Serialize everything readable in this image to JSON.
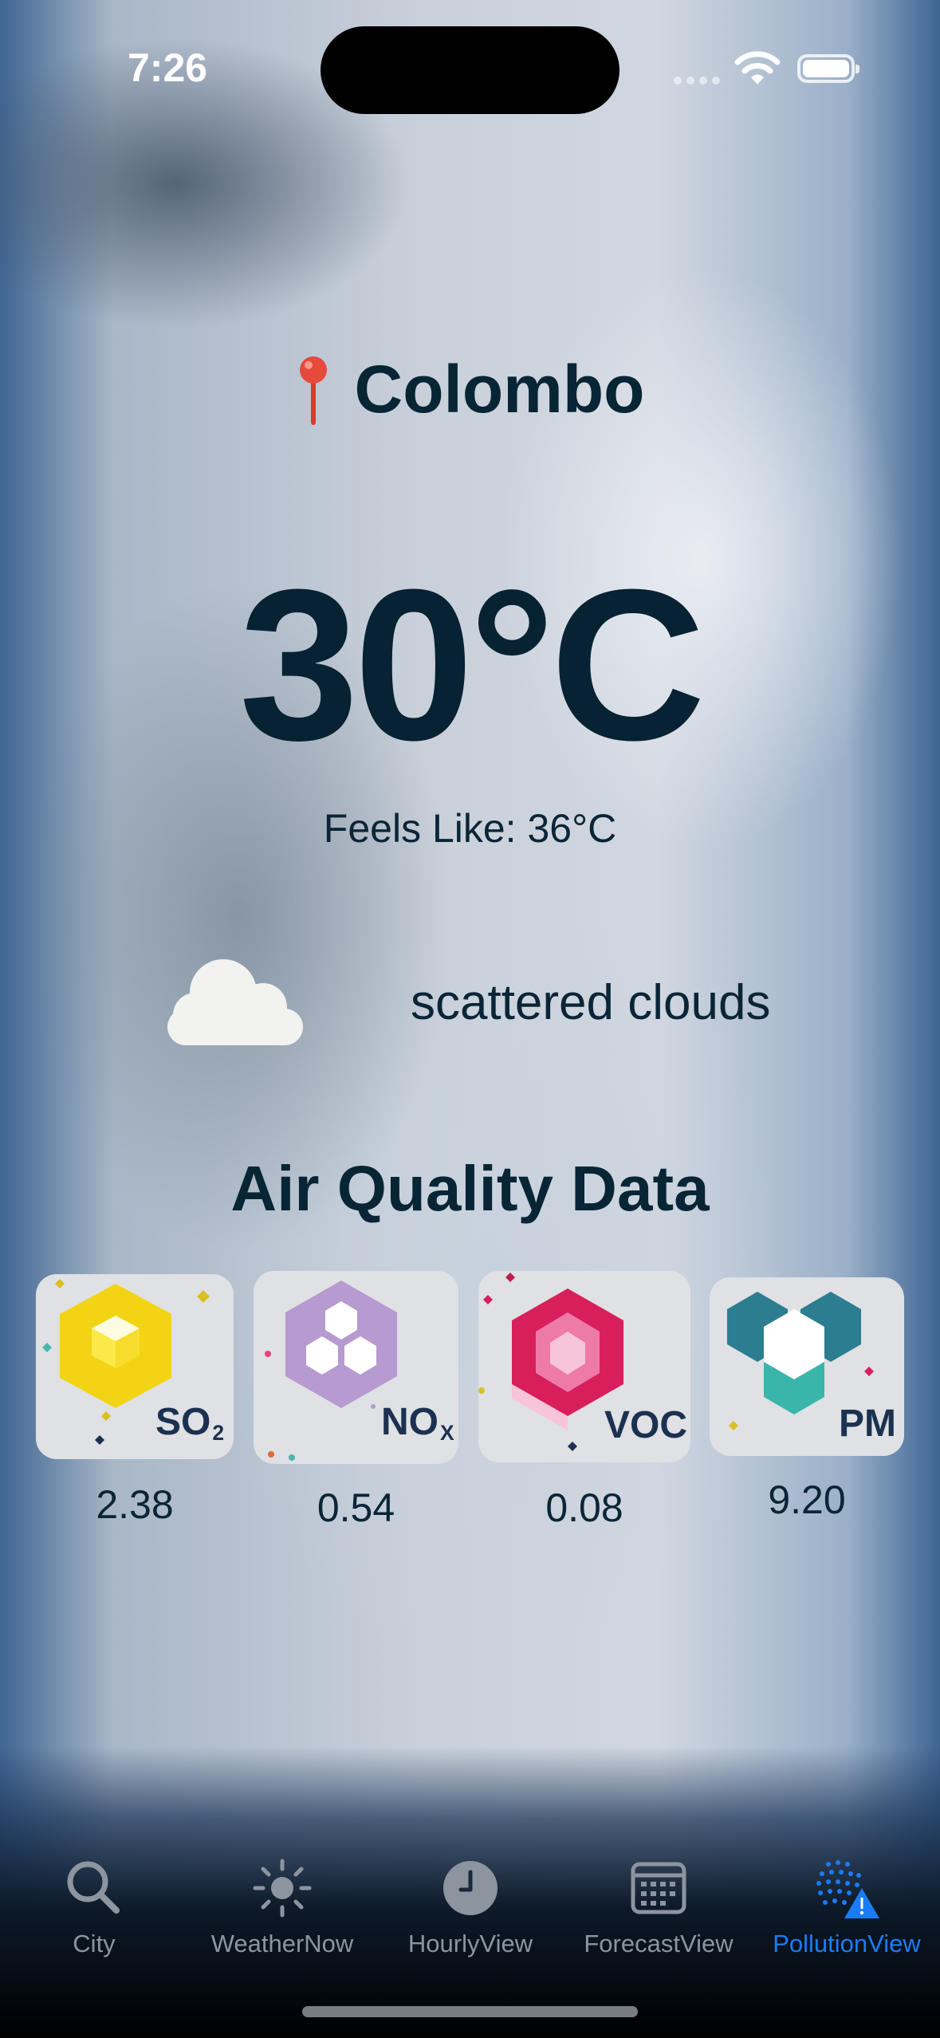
{
  "status_bar": {
    "time": "7:26"
  },
  "location": {
    "city": "Colombo",
    "icon": "map-pin-icon"
  },
  "current": {
    "temperature": "30°C",
    "feels_like": "Feels Like: 36°C",
    "condition": "scattered clouds",
    "condition_icon": "cloud-icon"
  },
  "air_quality": {
    "title": "Air Quality Data",
    "items": [
      {
        "name": "SO",
        "sub": "2",
        "value": "2.38",
        "icon": "so2-icon",
        "color": "#f2d415"
      },
      {
        "name": "NO",
        "sub": "X",
        "value": "0.54",
        "icon": "nox-icon",
        "color": "#b79ad0"
      },
      {
        "name": "VOC",
        "sub": "",
        "value": "0.08",
        "icon": "voc-icon",
        "color": "#e4437f"
      },
      {
        "name": "PM",
        "sub": "",
        "value": "9.20",
        "icon": "pm-icon",
        "color": "#2b8a95"
      }
    ]
  },
  "tabbar": {
    "active_color": "#1a7cf5",
    "items": [
      {
        "label": "City",
        "icon": "magnifying-glass-icon"
      },
      {
        "label": "WeatherNow",
        "icon": "sun-icon"
      },
      {
        "label": "HourlyView",
        "icon": "clock-icon"
      },
      {
        "label": "ForecastView",
        "icon": "calendar-icon"
      },
      {
        "label": "PollutionView",
        "icon": "aqi-warning-icon",
        "active": true
      }
    ]
  }
}
